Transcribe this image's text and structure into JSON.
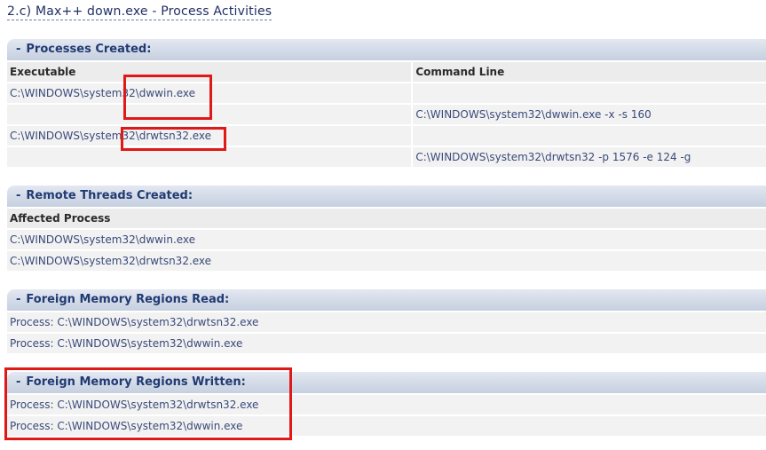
{
  "page_title": "2.c) Max++ down.exe - Process Activities",
  "processes": {
    "title": "Processes Created:",
    "col_executable": "Executable",
    "col_command_line": "Command Line",
    "rows": [
      {
        "exe": "C:\\WINDOWS\\system32\\dwwin.exe",
        "cmd": ""
      },
      {
        "exe": "",
        "cmd": "C:\\WINDOWS\\system32\\dwwin.exe -x -s 160"
      },
      {
        "exe": "C:\\WINDOWS\\system32\\drwtsn32.exe",
        "cmd": ""
      },
      {
        "exe": "",
        "cmd": "C:\\WINDOWS\\system32\\drwtsn32 -p 1576 -e 124 -g"
      }
    ]
  },
  "remote_threads": {
    "title": "Remote Threads Created:",
    "col_affected": "Affected Process",
    "rows": [
      "C:\\WINDOWS\\system32\\dwwin.exe",
      "C:\\WINDOWS\\system32\\drwtsn32.exe"
    ]
  },
  "memory_read": {
    "title": "Foreign Memory Regions Read:",
    "rows": [
      "Process: C:\\WINDOWS\\system32\\drwtsn32.exe",
      "Process: C:\\WINDOWS\\system32\\dwwin.exe"
    ]
  },
  "memory_written": {
    "title": "Foreign Memory Regions Written:",
    "rows": [
      "Process: C:\\WINDOWS\\system32\\drwtsn32.exe",
      "Process: C:\\WINDOWS\\system32\\dwwin.exe"
    ]
  },
  "header_dash": "-",
  "colors": {
    "highlight": "#e01818",
    "header_text": "#213a73"
  }
}
